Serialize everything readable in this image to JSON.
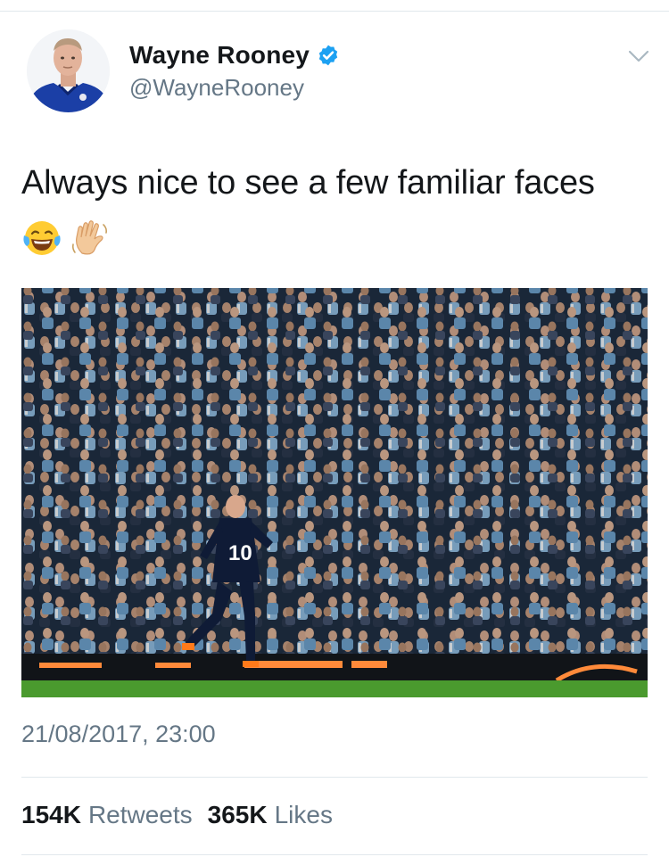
{
  "author": {
    "display_name": "Wayne Rooney",
    "handle": "@WayneRooney",
    "verified": true,
    "avatar_icon": "profile-photo-everton-kit"
  },
  "tweet": {
    "text": "Always nice to see a few familiar faces",
    "emojis": [
      "face-with-tears-of-joy-icon",
      "waving-hand-icon"
    ],
    "media_icon": "photo-football-player-celebrating-in-front-of-crowd",
    "player_number": "10",
    "timestamp": "21/08/2017, 23:00"
  },
  "stats": {
    "retweets_count": "154K",
    "retweets_label": "Retweets",
    "likes_count": "365K",
    "likes_label": "Likes"
  },
  "colors": {
    "verified_blue": "#1da1f2",
    "secondary_text": "#657786",
    "primary_text": "#14171a",
    "divider": "#e1e8ed",
    "everton_blue": "#1b3fa6"
  }
}
